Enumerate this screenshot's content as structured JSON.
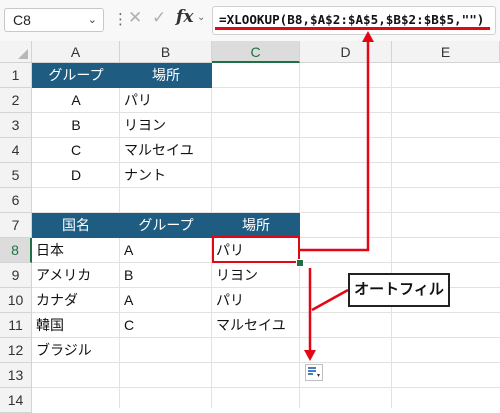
{
  "formula_bar": {
    "name_box": "C8",
    "formula": "=XLOOKUP(B8,$A$2:$A$5,$B$2:$B$5,\"\")"
  },
  "columns": [
    "A",
    "B",
    "C",
    "D",
    "E"
  ],
  "rows": [
    "1",
    "2",
    "3",
    "4",
    "5",
    "6",
    "7",
    "8",
    "9",
    "10",
    "11",
    "12",
    "13",
    "14"
  ],
  "table1": {
    "headers": [
      "グループ",
      "場所"
    ],
    "rows": [
      [
        "A",
        "パリ"
      ],
      [
        "B",
        "リヨン"
      ],
      [
        "C",
        "マルセイユ"
      ],
      [
        "D",
        "ナント"
      ]
    ]
  },
  "table2": {
    "headers": [
      "国名",
      "グループ",
      "場所"
    ],
    "rows": [
      [
        "日本",
        "A",
        "パリ"
      ],
      [
        "アメリカ",
        "B",
        "リヨン"
      ],
      [
        "カナダ",
        "A",
        "パリ"
      ],
      [
        "韓国",
        "C",
        "マルセイユ"
      ],
      [
        "ブラジル",
        "",
        ""
      ]
    ]
  },
  "annotation": {
    "callout": "オートフィル"
  },
  "colors": {
    "header_fill": "#1f5c82",
    "annotation_red": "#e30613",
    "selection_green": "#1e7145"
  },
  "icons": {
    "name_box_dropdown": "chevron-down-icon",
    "cancel": "x-icon",
    "enter": "check-icon",
    "function": "fx-icon",
    "autofill_options": "autofill-options-icon"
  }
}
